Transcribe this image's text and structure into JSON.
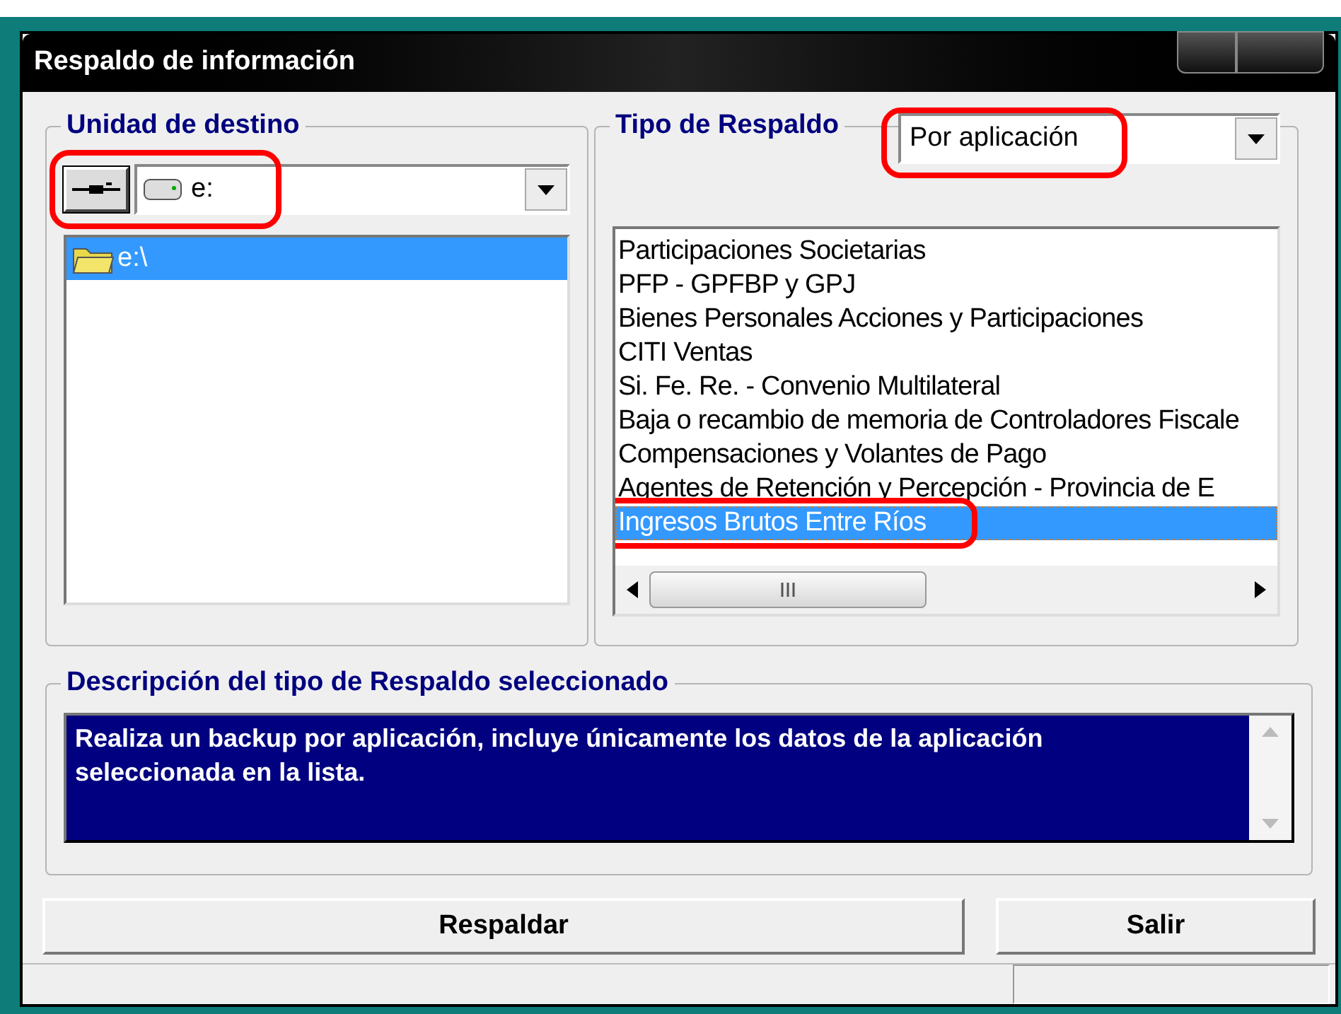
{
  "window": {
    "title": "Respaldo de información"
  },
  "destination": {
    "title": "Unidad de destino",
    "drive": "e:",
    "folders": [
      {
        "label": "e:\\",
        "selected": true
      }
    ]
  },
  "backup_type": {
    "title": "Tipo de Respaldo",
    "value": "Por aplicación",
    "items": [
      {
        "label": "Participaciones Societarias",
        "selected": false
      },
      {
        "label": "PFP - GPFBP y GPJ",
        "selected": false
      },
      {
        "label": "Bienes Personales Acciones y Participaciones",
        "selected": false
      },
      {
        "label": "CITI Ventas",
        "selected": false
      },
      {
        "label": "Si. Fe. Re. - Convenio Multilateral",
        "selected": false
      },
      {
        "label": "Baja o recambio de memoria de Controladores Fiscale",
        "selected": false
      },
      {
        "label": "Compensaciones y Volantes de Pago",
        "selected": false
      },
      {
        "label": "Agentes de Retención y Percepción - Provincia de E",
        "selected": false
      },
      {
        "label": "Ingresos Brutos Entre Ríos",
        "selected": true
      }
    ]
  },
  "description": {
    "title": "Descripción del tipo de Respaldo seleccionado",
    "text": "Realiza un backup por aplicación, incluye únicamente los datos de la aplicación seleccionada en la lista."
  },
  "buttons": [
    "Respaldar",
    "Salir"
  ]
}
